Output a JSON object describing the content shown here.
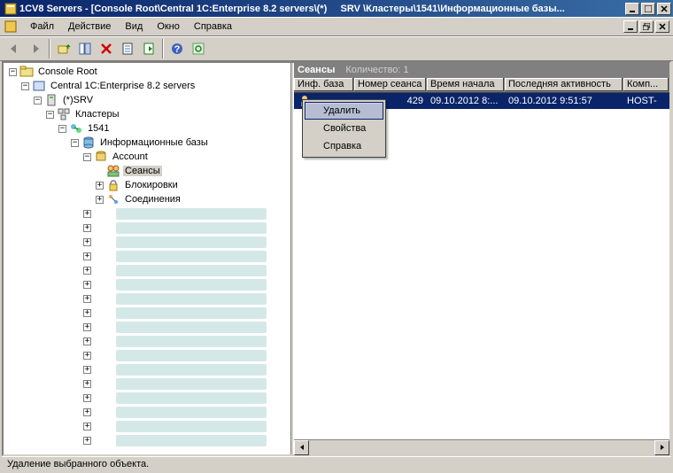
{
  "titlebar": {
    "prefix": "1CV8 Servers - [Console Root\\Central 1C:Enterprise 8.2 servers\\(*)",
    "suffix": "SRV   \\Кластеры\\1541\\Информационные базы..."
  },
  "menu": {
    "file": "Файл",
    "action": "Действие",
    "view": "Вид",
    "window": "Окно",
    "help": "Справка"
  },
  "tree": {
    "root": "Console Root",
    "central": "Central 1C:Enterprise 8.2 servers",
    "srv": "(*)SRV",
    "clusters": "Кластеры",
    "port": "1541",
    "infobases": "Информационные базы",
    "account": "Account",
    "sessions": "Сеансы",
    "locks": "Блокировки",
    "connections": "Соединения"
  },
  "list": {
    "title": "Сеансы",
    "count": "Количество: 1",
    "cols": {
      "infobase": "Инф. база",
      "session_num": "Номер сеанса",
      "start_time": "Время начала",
      "last_activity": "Последняя активность",
      "computer": "Комп..."
    },
    "row": {
      "num": "429",
      "start": "09.10.2012 8:...",
      "last": "09.10.2012 9:51:57",
      "host": "HOST-"
    }
  },
  "context_menu": {
    "delete": "Удалить",
    "properties": "Свойства",
    "help": "Справка"
  },
  "statusbar": "Удаление выбранного объекта."
}
